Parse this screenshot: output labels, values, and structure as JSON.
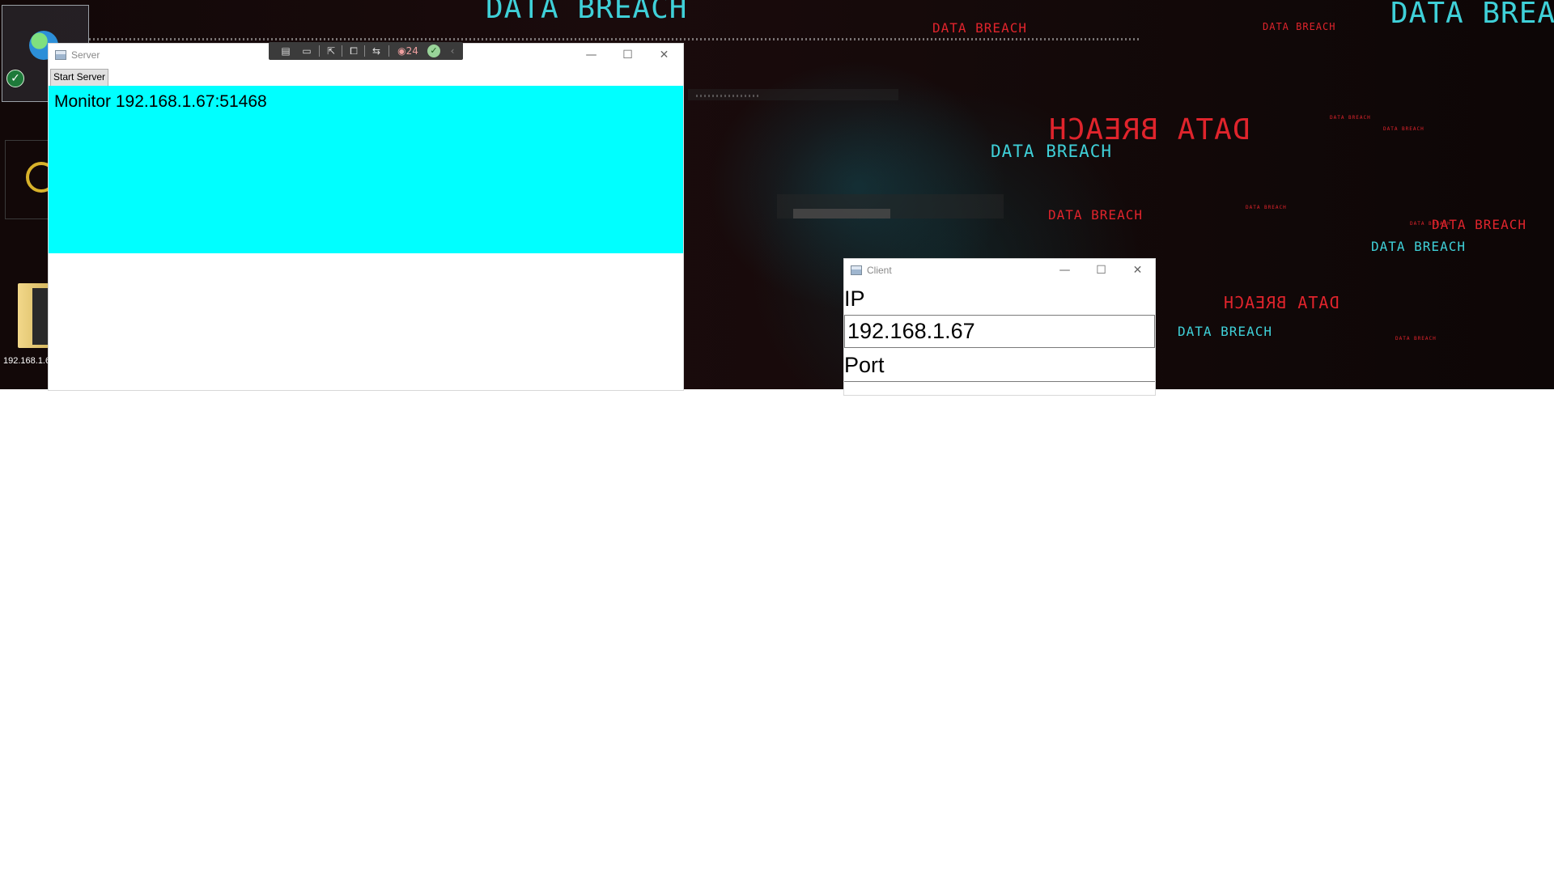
{
  "desktop": {
    "wallpaper_text": "DATA BREACH",
    "icon_label": "192.168.1.6"
  },
  "server_window": {
    "title": "Server",
    "start_button": "Start Server",
    "monitor_text": "Monitor 192.168.1.67:51468",
    "monitor_bg": "#00ffff"
  },
  "toolbar": {
    "counter": "24"
  },
  "client_window": {
    "title": "Client",
    "ip_label": "IP",
    "ip_value": "192.168.1.67",
    "port_label": "Port"
  }
}
